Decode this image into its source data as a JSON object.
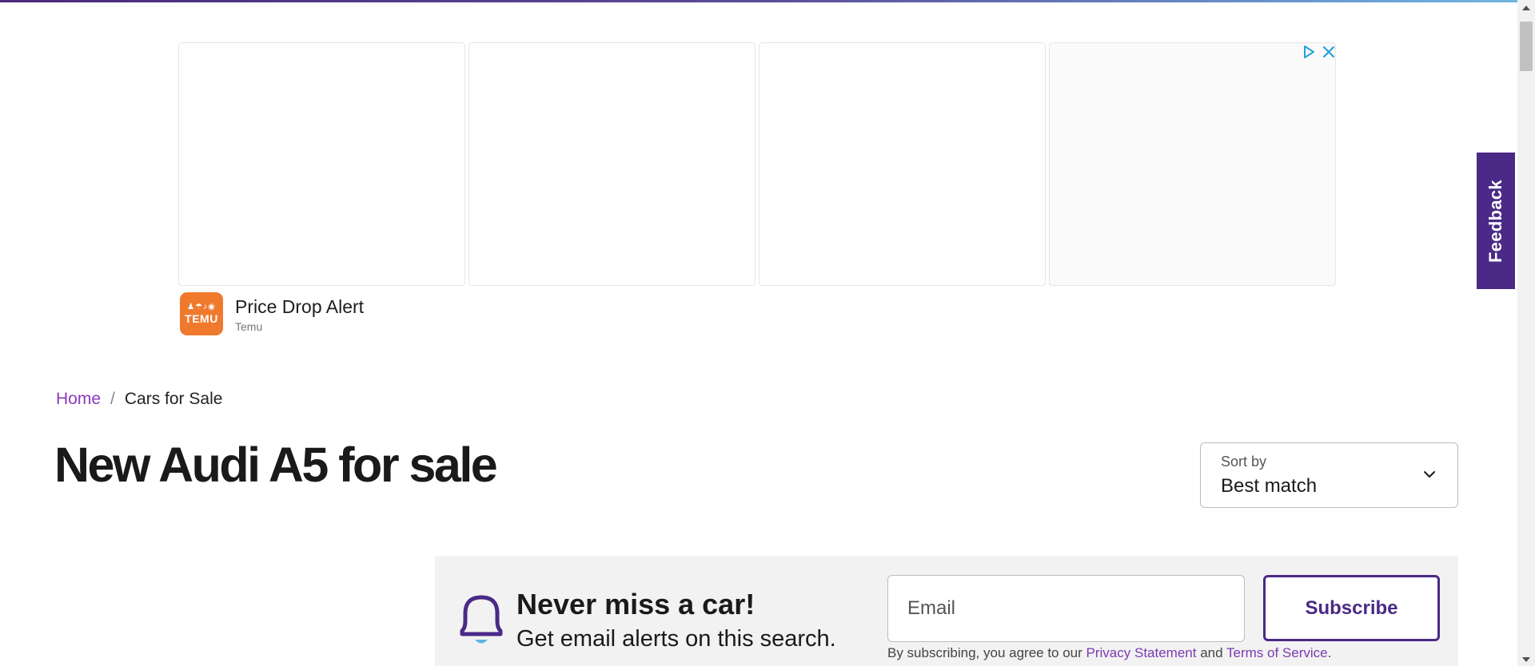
{
  "ad": {
    "title": "Price Drop Alert",
    "brand": "Temu",
    "logo_text": "TEMU",
    "logo_glyphs": "♟☂♪◉",
    "adchoices_icon": "play-triangle-icon",
    "close_icon": "close-icon"
  },
  "feedback": {
    "label": "Feedback"
  },
  "breadcrumb": {
    "home": "Home",
    "separator": "/",
    "current": "Cars for Sale"
  },
  "page": {
    "title": "New Audi A5 for sale"
  },
  "sort": {
    "label": "Sort by",
    "value": "Best match"
  },
  "alert": {
    "title": "Never miss a car!",
    "subtitle": "Get email alerts on this search.",
    "email_placeholder": "Email",
    "subscribe_label": "Subscribe",
    "disclaimer_prefix": "By subscribing, you agree to our ",
    "privacy_link": "Privacy Statement",
    "and": " and ",
    "terms_link": "Terms of Service",
    "period": "."
  },
  "colors": {
    "brand_purple": "#4a2a86",
    "link_purple": "#8a3ab9",
    "temu_orange": "#ef7a2e",
    "bell_accent": "#5bb6e6"
  }
}
